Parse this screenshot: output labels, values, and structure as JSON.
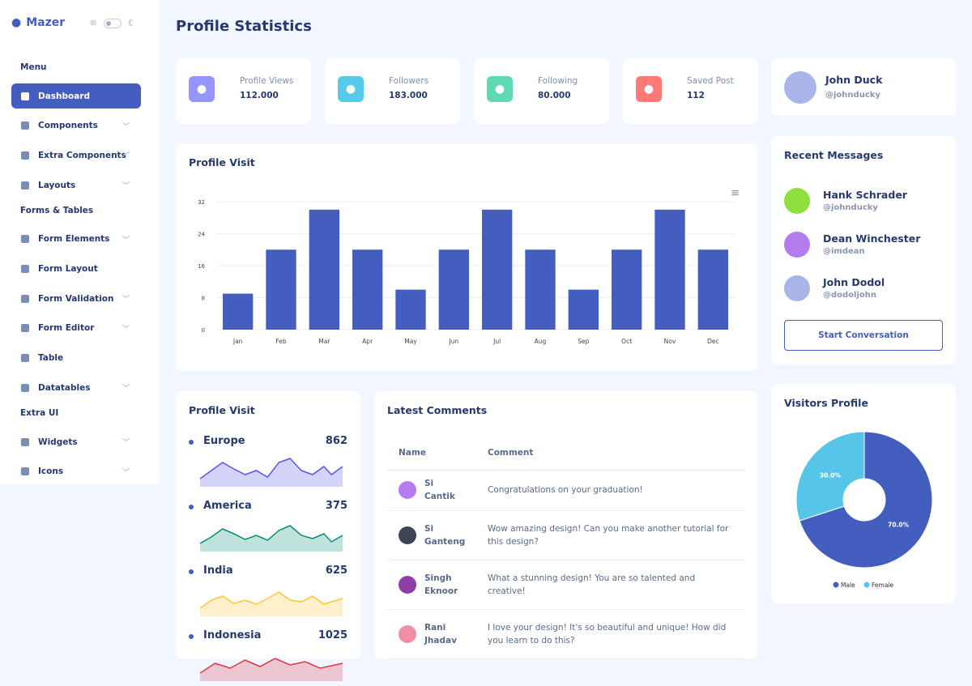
{
  "app": {
    "name": "Mazer"
  },
  "sidebar": {
    "sections": [
      {
        "title": "Menu",
        "items": [
          {
            "label": "Dashboard",
            "icon": "grid-icon",
            "active": true
          },
          {
            "label": "Components",
            "icon": "stack-icon",
            "chevron": true
          },
          {
            "label": "Extra Components",
            "icon": "collection-icon",
            "chevron": true
          },
          {
            "label": "Layouts",
            "icon": "layout-icon",
            "chevron": true
          }
        ]
      },
      {
        "title": "Forms & Tables",
        "items": [
          {
            "label": "Form Elements",
            "icon": "hexagon-icon",
            "chevron": true
          },
          {
            "label": "Form Layout",
            "icon": "file-icon"
          },
          {
            "label": "Form Validation",
            "icon": "checkbox-icon",
            "chevron": true
          },
          {
            "label": "Form Editor",
            "icon": "pen-icon",
            "chevron": true
          },
          {
            "label": "Table",
            "icon": "table-icon"
          },
          {
            "label": "Datatables",
            "icon": "spreadsheet-icon",
            "chevron": true
          }
        ]
      },
      {
        "title": "Extra UI",
        "items": [
          {
            "label": "Widgets",
            "icon": "pentagon-icon",
            "chevron": true
          },
          {
            "label": "Icons",
            "icon": "egg-icon",
            "chevron": true
          }
        ]
      }
    ]
  },
  "page": {
    "title": "Profile Statistics"
  },
  "stats": [
    {
      "label": "Profile Views",
      "value": "112.000",
      "icon": "eye-icon",
      "color": "#9694ff"
    },
    {
      "label": "Followers",
      "value": "183.000",
      "icon": "person-icon",
      "color": "#57caeb"
    },
    {
      "label": "Following",
      "value": "80.000",
      "icon": "person-plus-icon",
      "color": "#5ddab4"
    },
    {
      "label": "Saved Post",
      "value": "112",
      "icon": "bookmark-icon",
      "color": "#ff7976"
    }
  ],
  "profile": {
    "name": "John Duck",
    "handle": "@johnducky"
  },
  "profile_visit_chart": {
    "title": "Profile Visit",
    "menu_icon": "hamburger-icon"
  },
  "chart_data": {
    "type": "bar",
    "categories": [
      "Jan",
      "Feb",
      "Mar",
      "Apr",
      "May",
      "Jun",
      "Jul",
      "Aug",
      "Sep",
      "Oct",
      "Nov",
      "Dec"
    ],
    "values": [
      9,
      20,
      30,
      20,
      10,
      20,
      30,
      20,
      10,
      20,
      30,
      20
    ],
    "ylim": [
      0,
      32
    ],
    "yticks": [
      0,
      8,
      16,
      24,
      32
    ],
    "color": "#435ebe",
    "grid": true
  },
  "recent_messages": {
    "title": "Recent Messages",
    "items": [
      {
        "name": "Hank Schrader",
        "handle": "@johnducky",
        "color": "#8fe03c"
      },
      {
        "name": "Dean Winchester",
        "handle": "@imdean",
        "color": "#b57cf0"
      },
      {
        "name": "John Dodol",
        "handle": "@dodoljohn",
        "color": "#a9b4e8"
      }
    ],
    "button": "Start Conversation"
  },
  "regions": {
    "title": "Profile Visit",
    "items": [
      {
        "name": "Europe",
        "value": "862",
        "color": "#5350e9"
      },
      {
        "name": "America",
        "value": "375",
        "color": "#008b75"
      },
      {
        "name": "India",
        "value": "625",
        "color": "#ffc434"
      },
      {
        "name": "Indonesia",
        "value": "1025",
        "color": "#dc3545"
      }
    ]
  },
  "comments": {
    "title": "Latest Comments",
    "headers": [
      "Name",
      "Comment"
    ],
    "rows": [
      {
        "name": "Si Cantik",
        "comment": "Congratulations on your graduation!",
        "color": "#b57cf0"
      },
      {
        "name": "Si Ganteng",
        "comment": "Wow amazing design! Can you make another tutorial for this design?",
        "color": "#3d4456"
      },
      {
        "name": "Singh Eknoor",
        "comment": "What a stunning design! You are so talented and creative!",
        "color": "#8e3fa8"
      },
      {
        "name": "Rani Jhadav",
        "comment": "I love your design! It's so beautiful and unique! How did you learn to do this?",
        "color": "#f28fa8"
      }
    ]
  },
  "visitors": {
    "title": "Visitors Profile",
    "slices": [
      {
        "label": "Male",
        "value": 70,
        "text": "70.0%",
        "color": "#435ebe"
      },
      {
        "label": "Female",
        "value": 30,
        "text": "30.0%",
        "color": "#55c6e8"
      }
    ]
  }
}
